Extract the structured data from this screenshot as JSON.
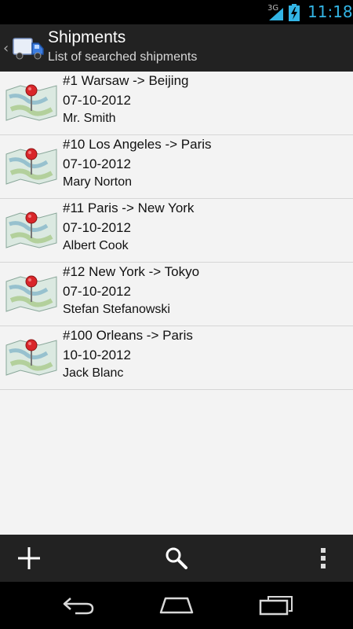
{
  "status_bar": {
    "network": "3G",
    "time": "11:18"
  },
  "action_bar": {
    "title": "Shipments",
    "subtitle": "List of searched shipments"
  },
  "shipments": [
    {
      "number": "#1",
      "route": "Warsaw -> Beijing",
      "date": "07-10-2012",
      "name": "Mr. Smith"
    },
    {
      "number": "#10",
      "route": "Los Angeles -> Paris",
      "date": "07-10-2012",
      "name": "Mary Norton"
    },
    {
      "number": "#11",
      "route": "Paris -> New York",
      "date": "07-10-2012",
      "name": "Albert Cook"
    },
    {
      "number": "#12",
      "route": "New York -> Tokyo",
      "date": "07-10-2012",
      "name": "Stefan Stefanowski"
    },
    {
      "number": "#100",
      "route": "Orleans -> Paris",
      "date": "10-10-2012",
      "name": "Jack Blanc"
    }
  ],
  "icons": {
    "app": "truck-icon",
    "list_item": "map-pin-icon",
    "add": "plus-icon",
    "search": "search-icon",
    "overflow": "overflow-menu-icon",
    "back": "back-icon",
    "home": "home-icon",
    "recents": "recent-apps-icon"
  },
  "colors": {
    "accent": "#33b5e5",
    "action_bar": "#222222",
    "list_background": "#f3f3f3"
  }
}
